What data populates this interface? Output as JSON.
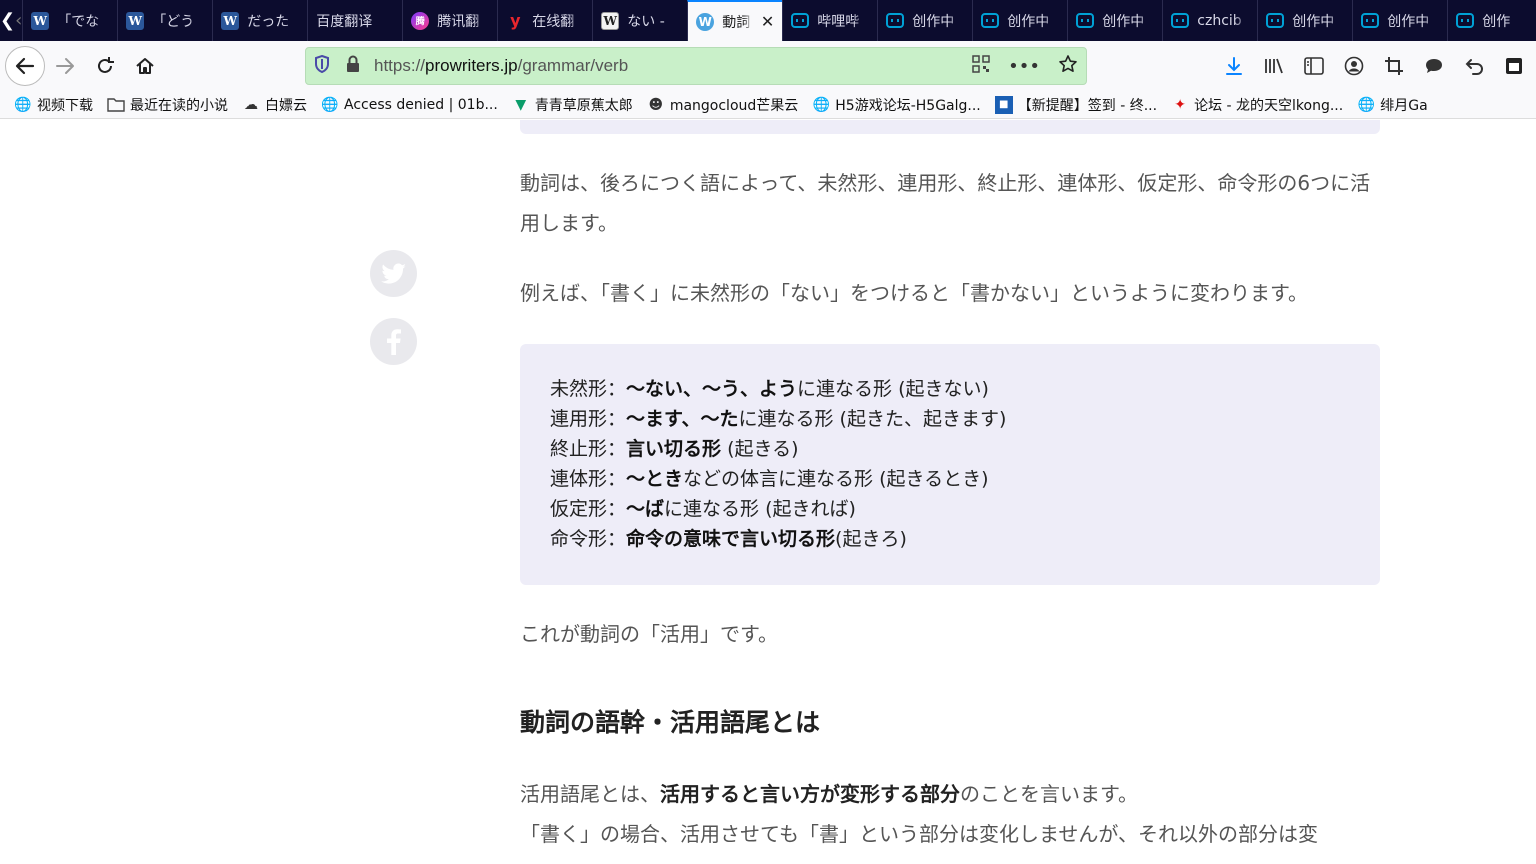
{
  "tabs": [
    {
      "icon": "W",
      "label": "「でな"
    },
    {
      "icon": "W",
      "label": "「どう"
    },
    {
      "icon": "W",
      "label": "だった"
    },
    {
      "icon": "",
      "label": "百度翻译"
    },
    {
      "icon": "腾",
      "label": "腾讯翻"
    },
    {
      "icon": "y",
      "label": "在线翻"
    },
    {
      "icon": "W",
      "label": "ない -"
    },
    {
      "icon": "W",
      "label": "動詞",
      "active": true
    },
    {
      "icon": "",
      "label": "哔哩哔"
    },
    {
      "icon": "",
      "label": "创作中"
    },
    {
      "icon": "",
      "label": "创作中"
    },
    {
      "icon": "",
      "label": "创作中"
    },
    {
      "icon": "",
      "label": "czhcib"
    },
    {
      "icon": "",
      "label": "创作中"
    },
    {
      "icon": "",
      "label": "创作中"
    },
    {
      "icon": "",
      "label": "创作"
    }
  ],
  "tab_close": "✕",
  "url": {
    "prefix": "https://",
    "host": "prowriters.jp",
    "path": "/grammar/verb"
  },
  "bookmarks": [
    {
      "label": "视频下载"
    },
    {
      "label": "最近在读的小说"
    },
    {
      "label": "白嫖云"
    },
    {
      "label": "Access denied | 01b..."
    },
    {
      "label": "青青草原蕉太郎"
    },
    {
      "label": "mangocloud芒果云"
    },
    {
      "label": "H5游戏论坛-H5Galg..."
    },
    {
      "label": "【新提醒】签到 - 终..."
    },
    {
      "label": "论坛 - 龙的天空lkong..."
    },
    {
      "label": "绯月Ga"
    }
  ],
  "article": {
    "p1": "動詞は、後ろにつく語によって、未然形、連用形、終止形、連体形、仮定形、命令形の6つに活用します。",
    "p2": "例えば、「書く」に未然形の「ない」をつけると「書かない」というように変わります。",
    "forms": [
      {
        "name": "未然形：",
        "bold": "～ない、～う、よう",
        "rest": "に連なる形 (起きない)"
      },
      {
        "name": "連用形：",
        "bold": "～ます、～た",
        "rest": "に連なる形 (起きた、起きます)"
      },
      {
        "name": "終止形：",
        "bold": "言い切る形",
        "rest": " (起きる)"
      },
      {
        "name": "連体形：",
        "bold": "～とき",
        "rest": "などの体言に連なる形 (起きるとき)"
      },
      {
        "name": "仮定形：",
        "bold": "～ば",
        "rest": "に連なる形 (起きれば)"
      },
      {
        "name": "命令形：",
        "bold": "命令の意味で言い切る形",
        "rest": "(起きろ)"
      }
    ],
    "p3": "これが動詞の「活用」です。",
    "h2": "動詞の語幹・活用語尾とは",
    "p4_pre": "活用語尾とは、",
    "p4_bold": "活用すると言い方が変形する部分",
    "p4_post": "のことを言います。",
    "p5": "「書く」の場合、活用させても「書」という部分は変化しませんが、それ以外の部分は変"
  }
}
